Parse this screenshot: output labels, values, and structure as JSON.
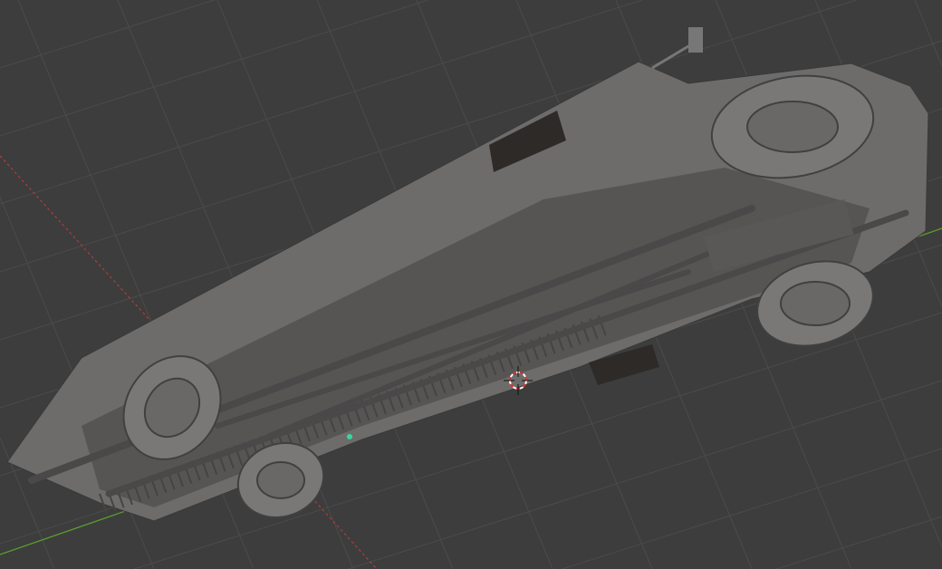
{
  "viewport": {
    "mode": "3d-viewport",
    "background_color": "#3d3d3d",
    "grid_color": "#4b4b4b",
    "x_axis_color": "#c43c3c",
    "y_axis_color": "#5aa02c",
    "model_color": "#6e6c6b",
    "object_origin_color": "#3ad6a0",
    "icons": [
      "3d-cursor-icon",
      "object-origin-icon"
    ]
  }
}
